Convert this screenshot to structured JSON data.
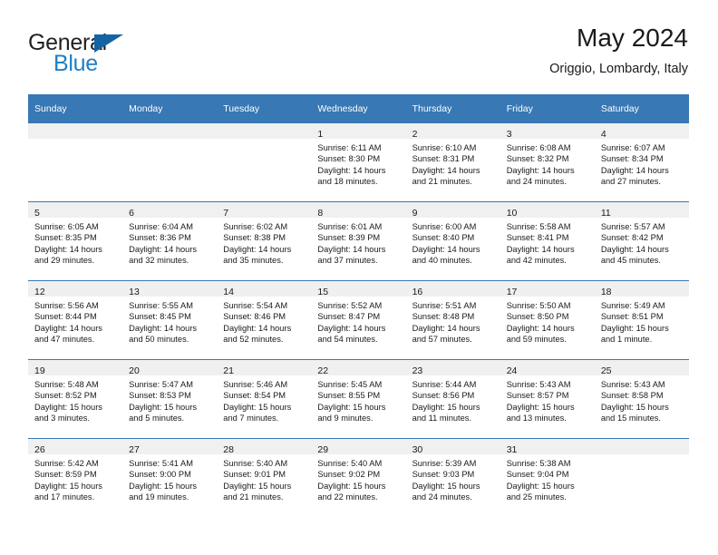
{
  "logo": {
    "word_top": "General",
    "word_bottom": "Blue",
    "triangle_color": "#1464a5",
    "blue_color": "#1f7fc4"
  },
  "header": {
    "title": "May 2024",
    "subtitle": "Origgio, Lombardy, Italy"
  },
  "theme": {
    "header_bg": "#3878b4",
    "header_text": "#ffffff",
    "daynum_band_bg": "#f0f0f0",
    "row_separator": "#3878b4"
  },
  "weekday_headers": [
    "Sunday",
    "Monday",
    "Tuesday",
    "Wednesday",
    "Thursday",
    "Friday",
    "Saturday"
  ],
  "weeks": [
    [
      {
        "day": "",
        "sunrise": "",
        "sunset": "",
        "daylight1": "",
        "daylight2": ""
      },
      {
        "day": "",
        "sunrise": "",
        "sunset": "",
        "daylight1": "",
        "daylight2": ""
      },
      {
        "day": "",
        "sunrise": "",
        "sunset": "",
        "daylight1": "",
        "daylight2": ""
      },
      {
        "day": "1",
        "sunrise": "Sunrise: 6:11 AM",
        "sunset": "Sunset: 8:30 PM",
        "daylight1": "Daylight: 14 hours",
        "daylight2": "and 18 minutes."
      },
      {
        "day": "2",
        "sunrise": "Sunrise: 6:10 AM",
        "sunset": "Sunset: 8:31 PM",
        "daylight1": "Daylight: 14 hours",
        "daylight2": "and 21 minutes."
      },
      {
        "day": "3",
        "sunrise": "Sunrise: 6:08 AM",
        "sunset": "Sunset: 8:32 PM",
        "daylight1": "Daylight: 14 hours",
        "daylight2": "and 24 minutes."
      },
      {
        "day": "4",
        "sunrise": "Sunrise: 6:07 AM",
        "sunset": "Sunset: 8:34 PM",
        "daylight1": "Daylight: 14 hours",
        "daylight2": "and 27 minutes."
      }
    ],
    [
      {
        "day": "5",
        "sunrise": "Sunrise: 6:05 AM",
        "sunset": "Sunset: 8:35 PM",
        "daylight1": "Daylight: 14 hours",
        "daylight2": "and 29 minutes."
      },
      {
        "day": "6",
        "sunrise": "Sunrise: 6:04 AM",
        "sunset": "Sunset: 8:36 PM",
        "daylight1": "Daylight: 14 hours",
        "daylight2": "and 32 minutes."
      },
      {
        "day": "7",
        "sunrise": "Sunrise: 6:02 AM",
        "sunset": "Sunset: 8:38 PM",
        "daylight1": "Daylight: 14 hours",
        "daylight2": "and 35 minutes."
      },
      {
        "day": "8",
        "sunrise": "Sunrise: 6:01 AM",
        "sunset": "Sunset: 8:39 PM",
        "daylight1": "Daylight: 14 hours",
        "daylight2": "and 37 minutes."
      },
      {
        "day": "9",
        "sunrise": "Sunrise: 6:00 AM",
        "sunset": "Sunset: 8:40 PM",
        "daylight1": "Daylight: 14 hours",
        "daylight2": "and 40 minutes."
      },
      {
        "day": "10",
        "sunrise": "Sunrise: 5:58 AM",
        "sunset": "Sunset: 8:41 PM",
        "daylight1": "Daylight: 14 hours",
        "daylight2": "and 42 minutes."
      },
      {
        "day": "11",
        "sunrise": "Sunrise: 5:57 AM",
        "sunset": "Sunset: 8:42 PM",
        "daylight1": "Daylight: 14 hours",
        "daylight2": "and 45 minutes."
      }
    ],
    [
      {
        "day": "12",
        "sunrise": "Sunrise: 5:56 AM",
        "sunset": "Sunset: 8:44 PM",
        "daylight1": "Daylight: 14 hours",
        "daylight2": "and 47 minutes."
      },
      {
        "day": "13",
        "sunrise": "Sunrise: 5:55 AM",
        "sunset": "Sunset: 8:45 PM",
        "daylight1": "Daylight: 14 hours",
        "daylight2": "and 50 minutes."
      },
      {
        "day": "14",
        "sunrise": "Sunrise: 5:54 AM",
        "sunset": "Sunset: 8:46 PM",
        "daylight1": "Daylight: 14 hours",
        "daylight2": "and 52 minutes."
      },
      {
        "day": "15",
        "sunrise": "Sunrise: 5:52 AM",
        "sunset": "Sunset: 8:47 PM",
        "daylight1": "Daylight: 14 hours",
        "daylight2": "and 54 minutes."
      },
      {
        "day": "16",
        "sunrise": "Sunrise: 5:51 AM",
        "sunset": "Sunset: 8:48 PM",
        "daylight1": "Daylight: 14 hours",
        "daylight2": "and 57 minutes."
      },
      {
        "day": "17",
        "sunrise": "Sunrise: 5:50 AM",
        "sunset": "Sunset: 8:50 PM",
        "daylight1": "Daylight: 14 hours",
        "daylight2": "and 59 minutes."
      },
      {
        "day": "18",
        "sunrise": "Sunrise: 5:49 AM",
        "sunset": "Sunset: 8:51 PM",
        "daylight1": "Daylight: 15 hours",
        "daylight2": "and 1 minute."
      }
    ],
    [
      {
        "day": "19",
        "sunrise": "Sunrise: 5:48 AM",
        "sunset": "Sunset: 8:52 PM",
        "daylight1": "Daylight: 15 hours",
        "daylight2": "and 3 minutes."
      },
      {
        "day": "20",
        "sunrise": "Sunrise: 5:47 AM",
        "sunset": "Sunset: 8:53 PM",
        "daylight1": "Daylight: 15 hours",
        "daylight2": "and 5 minutes."
      },
      {
        "day": "21",
        "sunrise": "Sunrise: 5:46 AM",
        "sunset": "Sunset: 8:54 PM",
        "daylight1": "Daylight: 15 hours",
        "daylight2": "and 7 minutes."
      },
      {
        "day": "22",
        "sunrise": "Sunrise: 5:45 AM",
        "sunset": "Sunset: 8:55 PM",
        "daylight1": "Daylight: 15 hours",
        "daylight2": "and 9 minutes."
      },
      {
        "day": "23",
        "sunrise": "Sunrise: 5:44 AM",
        "sunset": "Sunset: 8:56 PM",
        "daylight1": "Daylight: 15 hours",
        "daylight2": "and 11 minutes."
      },
      {
        "day": "24",
        "sunrise": "Sunrise: 5:43 AM",
        "sunset": "Sunset: 8:57 PM",
        "daylight1": "Daylight: 15 hours",
        "daylight2": "and 13 minutes."
      },
      {
        "day": "25",
        "sunrise": "Sunrise: 5:43 AM",
        "sunset": "Sunset: 8:58 PM",
        "daylight1": "Daylight: 15 hours",
        "daylight2": "and 15 minutes."
      }
    ],
    [
      {
        "day": "26",
        "sunrise": "Sunrise: 5:42 AM",
        "sunset": "Sunset: 8:59 PM",
        "daylight1": "Daylight: 15 hours",
        "daylight2": "and 17 minutes."
      },
      {
        "day": "27",
        "sunrise": "Sunrise: 5:41 AM",
        "sunset": "Sunset: 9:00 PM",
        "daylight1": "Daylight: 15 hours",
        "daylight2": "and 19 minutes."
      },
      {
        "day": "28",
        "sunrise": "Sunrise: 5:40 AM",
        "sunset": "Sunset: 9:01 PM",
        "daylight1": "Daylight: 15 hours",
        "daylight2": "and 21 minutes."
      },
      {
        "day": "29",
        "sunrise": "Sunrise: 5:40 AM",
        "sunset": "Sunset: 9:02 PM",
        "daylight1": "Daylight: 15 hours",
        "daylight2": "and 22 minutes."
      },
      {
        "day": "30",
        "sunrise": "Sunrise: 5:39 AM",
        "sunset": "Sunset: 9:03 PM",
        "daylight1": "Daylight: 15 hours",
        "daylight2": "and 24 minutes."
      },
      {
        "day": "31",
        "sunrise": "Sunrise: 5:38 AM",
        "sunset": "Sunset: 9:04 PM",
        "daylight1": "Daylight: 15 hours",
        "daylight2": "and 25 minutes."
      },
      {
        "day": "",
        "sunrise": "",
        "sunset": "",
        "daylight1": "",
        "daylight2": ""
      }
    ]
  ]
}
